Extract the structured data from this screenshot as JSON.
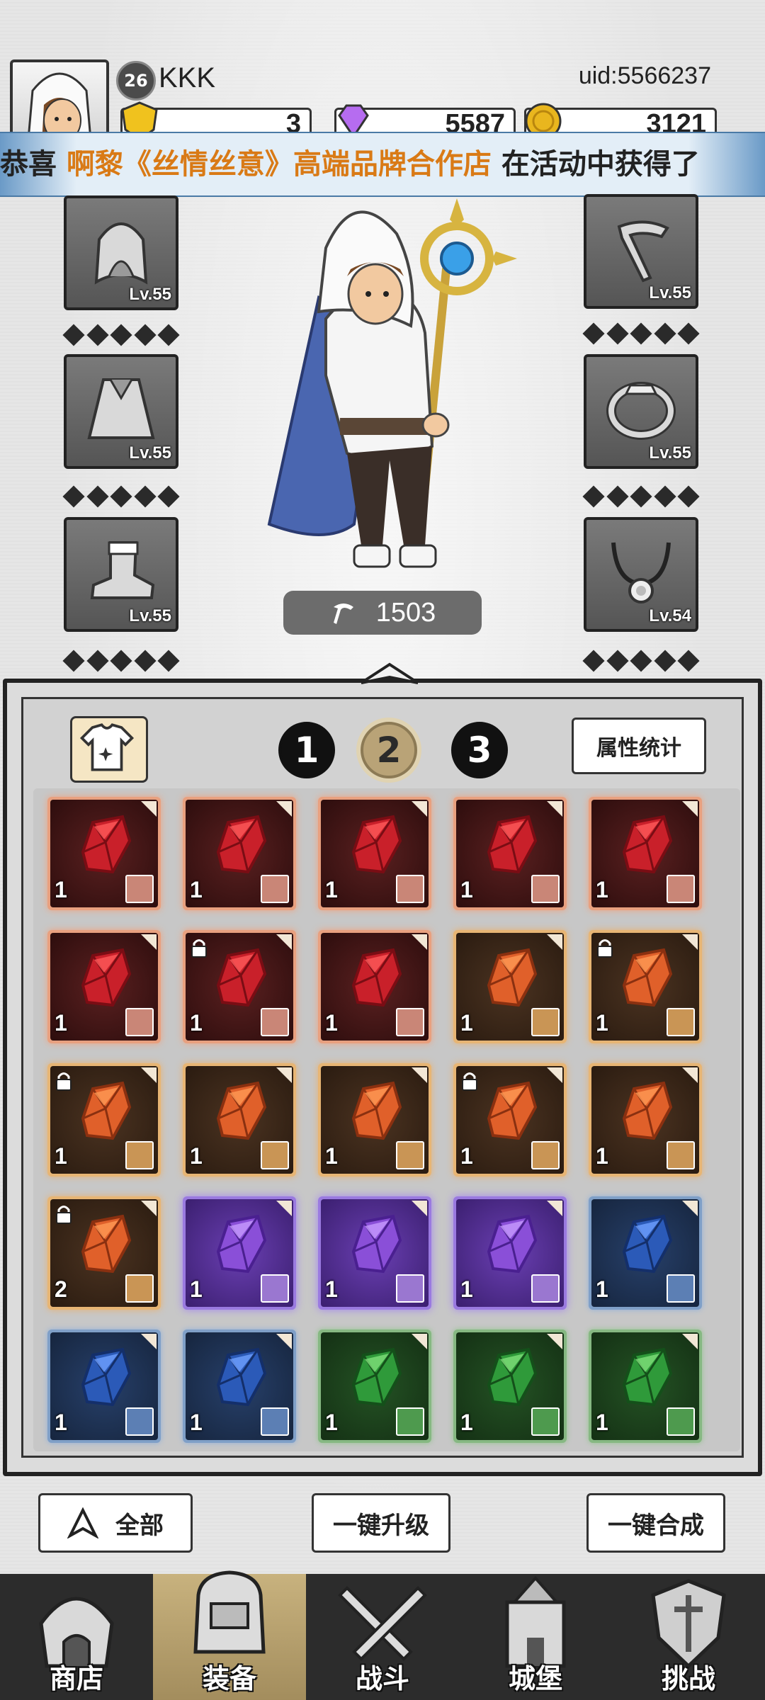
{
  "player": {
    "level": "26",
    "name": "KKK",
    "uid": "uid:5566237"
  },
  "resources": [
    {
      "icon": "gold-shield-icon",
      "value": "3"
    },
    {
      "icon": "purple-gem-icon",
      "value": "5587"
    },
    {
      "icon": "gold-coin-icon",
      "value": "3121"
    }
  ],
  "marquee": {
    "prefix": "恭喜 ",
    "highlight": "啊黎《丝情丝意》高端品牌合作店",
    "suffix": " 在活动中获得了"
  },
  "equipment": {
    "left": [
      {
        "name": "hood",
        "level": "Lv.55"
      },
      {
        "name": "cape",
        "level": "Lv.55"
      },
      {
        "name": "boots",
        "level": "Lv.55"
      }
    ],
    "right": [
      {
        "name": "staff",
        "level": "Lv.55"
      },
      {
        "name": "ring",
        "level": "Lv.55"
      },
      {
        "name": "necklace",
        "level": "Lv.54"
      }
    ]
  },
  "power": "1503",
  "tabs": [
    "1",
    "2",
    "3"
  ],
  "active_tab": "2",
  "stats_button": "属性统计",
  "inventory": [
    {
      "rarity": "red",
      "count": "1",
      "lock": false
    },
    {
      "rarity": "red",
      "count": "1",
      "lock": false
    },
    {
      "rarity": "red",
      "count": "1",
      "lock": false
    },
    {
      "rarity": "red",
      "count": "1",
      "lock": false
    },
    {
      "rarity": "red",
      "count": "1",
      "lock": false
    },
    {
      "rarity": "red",
      "count": "1",
      "lock": false
    },
    {
      "rarity": "red",
      "count": "1",
      "lock": true
    },
    {
      "rarity": "red",
      "count": "1",
      "lock": false
    },
    {
      "rarity": "orange",
      "count": "1",
      "lock": false
    },
    {
      "rarity": "orange",
      "count": "1",
      "lock": true
    },
    {
      "rarity": "orange",
      "count": "1",
      "lock": true
    },
    {
      "rarity": "orange",
      "count": "1",
      "lock": false
    },
    {
      "rarity": "orange",
      "count": "1",
      "lock": false
    },
    {
      "rarity": "orange",
      "count": "1",
      "lock": true
    },
    {
      "rarity": "orange",
      "count": "1",
      "lock": false
    },
    {
      "rarity": "orange",
      "count": "2",
      "lock": true
    },
    {
      "rarity": "purple",
      "count": "1",
      "lock": false
    },
    {
      "rarity": "purple",
      "count": "1",
      "lock": false
    },
    {
      "rarity": "purple",
      "count": "1",
      "lock": false
    },
    {
      "rarity": "blue",
      "count": "1",
      "lock": false
    },
    {
      "rarity": "blue",
      "count": "1",
      "lock": false
    },
    {
      "rarity": "blue",
      "count": "1",
      "lock": false
    },
    {
      "rarity": "green",
      "count": "1",
      "lock": false
    },
    {
      "rarity": "green",
      "count": "1",
      "lock": false
    },
    {
      "rarity": "green",
      "count": "1",
      "lock": false
    }
  ],
  "actions": {
    "filter": "全部",
    "upgrade_all": "一键升级",
    "merge_all": "一键合成"
  },
  "nav": [
    {
      "label": "商店",
      "icon": "shop-icon"
    },
    {
      "label": "装备",
      "icon": "backpack-icon"
    },
    {
      "label": "战斗",
      "icon": "crossed-swords-icon"
    },
    {
      "label": "城堡",
      "icon": "castle-icon"
    },
    {
      "label": "挑战",
      "icon": "challenge-shield-icon"
    }
  ],
  "colors": {
    "red": "#c9202a",
    "orange": "#e0602a",
    "purple": "#8a4fd8",
    "blue": "#2b5ab8",
    "green": "#2f9a3a",
    "accent": "#d97a16"
  }
}
